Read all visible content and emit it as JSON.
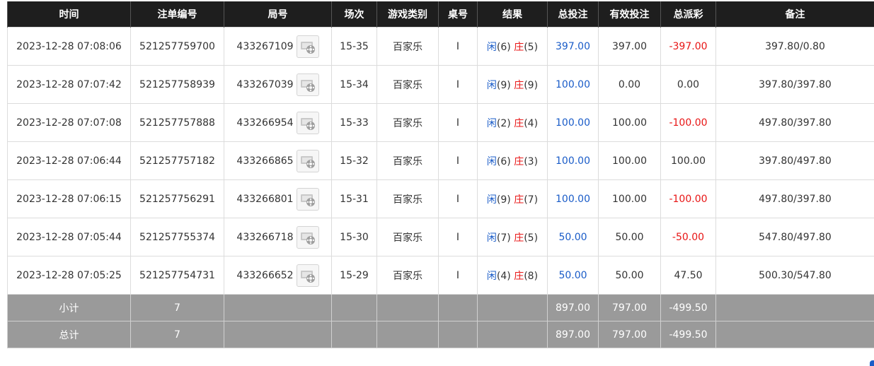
{
  "headers": [
    "时间",
    "注单编号",
    "局号",
    "场次",
    "游戏类别",
    "桌号",
    "结果",
    "总投注",
    "有效投注",
    "总派彩",
    "备注"
  ],
  "rows": [
    {
      "time": "2023-12-28 07:08:06",
      "bet_id": "521257759700",
      "round": "433267109",
      "session": "15-35",
      "game": "百家乐",
      "table": "I",
      "player_label": "闲",
      "player_score": "(6)",
      "banker_label": "庄",
      "banker_score": "(5)",
      "total_bet": "397.00",
      "valid_bet": "397.00",
      "payout": "-397.00",
      "payout_negative": true,
      "note": "397.80/0.80"
    },
    {
      "time": "2023-12-28 07:07:42",
      "bet_id": "521257758939",
      "round": "433267039",
      "session": "15-34",
      "game": "百家乐",
      "table": "I",
      "player_label": "闲",
      "player_score": "(9)",
      "banker_label": "庄",
      "banker_score": "(9)",
      "total_bet": "100.00",
      "valid_bet": "0.00",
      "payout": "0.00",
      "payout_negative": false,
      "note": "397.80/397.80"
    },
    {
      "time": "2023-12-28 07:07:08",
      "bet_id": "521257757888",
      "round": "433266954",
      "session": "15-33",
      "game": "百家乐",
      "table": "I",
      "player_label": "闲",
      "player_score": "(2)",
      "banker_label": "庄",
      "banker_score": "(4)",
      "total_bet": "100.00",
      "valid_bet": "100.00",
      "payout": "-100.00",
      "payout_negative": true,
      "note": "497.80/397.80"
    },
    {
      "time": "2023-12-28 07:06:44",
      "bet_id": "521257757182",
      "round": "433266865",
      "session": "15-32",
      "game": "百家乐",
      "table": "I",
      "player_label": "闲",
      "player_score": "(6)",
      "banker_label": "庄",
      "banker_score": "(3)",
      "total_bet": "100.00",
      "valid_bet": "100.00",
      "payout": "100.00",
      "payout_negative": false,
      "note": "397.80/497.80"
    },
    {
      "time": "2023-12-28 07:06:15",
      "bet_id": "521257756291",
      "round": "433266801",
      "session": "15-31",
      "game": "百家乐",
      "table": "I",
      "player_label": "闲",
      "player_score": "(9)",
      "banker_label": "庄",
      "banker_score": "(7)",
      "total_bet": "100.00",
      "valid_bet": "100.00",
      "payout": "-100.00",
      "payout_negative": true,
      "note": "497.80/397.80"
    },
    {
      "time": "2023-12-28 07:05:44",
      "bet_id": "521257755374",
      "round": "433266718",
      "session": "15-30",
      "game": "百家乐",
      "table": "I",
      "player_label": "闲",
      "player_score": "(7)",
      "banker_label": "庄",
      "banker_score": "(5)",
      "total_bet": "50.00",
      "valid_bet": "50.00",
      "payout": "-50.00",
      "payout_negative": true,
      "note": "547.80/497.80"
    },
    {
      "time": "2023-12-28 07:05:25",
      "bet_id": "521257754731",
      "round": "433266652",
      "session": "15-29",
      "game": "百家乐",
      "table": "I",
      "player_label": "闲",
      "player_score": "(4)",
      "banker_label": "庄",
      "banker_score": "(8)",
      "total_bet": "50.00",
      "valid_bet": "50.00",
      "payout": "47.50",
      "payout_negative": false,
      "note": "500.30/547.80"
    }
  ],
  "subtotal": {
    "label": "小计",
    "count": "7",
    "total_bet": "897.00",
    "valid_bet": "797.00",
    "payout": "-499.50"
  },
  "total": {
    "label": "总计",
    "count": "7",
    "total_bet": "897.00",
    "valid_bet": "797.00",
    "payout": "-499.50"
  },
  "colors": {
    "header_bg": "#1e1e1e",
    "summary_bg": "#9a9a9a",
    "positive_blue": "#1a5cc8",
    "negative_red": "#e81515"
  },
  "icons": {
    "round_video": "video-replay-icon"
  }
}
